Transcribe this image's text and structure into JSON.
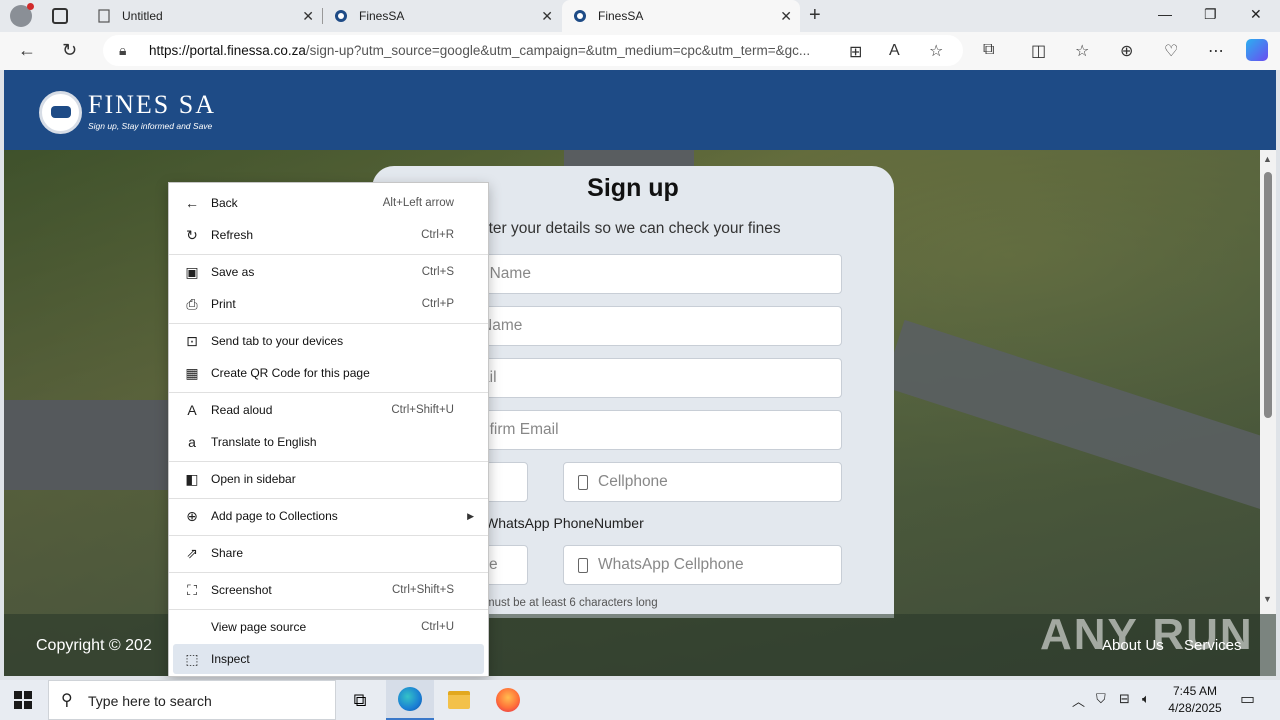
{
  "browser": {
    "tabs": [
      {
        "label": "Untitled",
        "active": false
      },
      {
        "label": "FinesSA",
        "active": false
      },
      {
        "label": "FinesSA",
        "active": true
      }
    ],
    "url_host": "https://portal.finessa.co.za",
    "url_rest": "/sign-up?utm_source=google&utm_campaign=&utm_medium=cpc&utm_term=&gc..."
  },
  "site": {
    "logo_text": "FINES SA",
    "logo_tagline": "Sign up, Stay informed and Save"
  },
  "form": {
    "title": "Sign up",
    "subtitle": "nter your details so we can check your fines",
    "first_name_placeholder": "t Name",
    "last_name_placeholder": " Name",
    "email_placeholder": "ail",
    "confirm_email_placeholder": "nfirm Email",
    "cellphone_placeholder": "Cellphone",
    "whatsapp_label": "WhatsApp PhoneNumber",
    "whatsapp_code_placeholder": "e",
    "whatsapp_cell_placeholder": "WhatsApp Cellphone",
    "password_hint": "must be at least 6 characters long"
  },
  "footer": {
    "copyright": "Copyright © 202",
    "about": "About Us",
    "services": "Services",
    "watermark": "ANY RUN"
  },
  "context_menu": [
    {
      "icon": "back-arrow-icon",
      "label": "Back",
      "shortcut": "Alt+Left arrow"
    },
    {
      "icon": "refresh-icon",
      "label": "Refresh",
      "shortcut": "Ctrl+R"
    },
    {
      "icon": "save-icon",
      "label": "Save as",
      "shortcut": "Ctrl+S"
    },
    {
      "icon": "print-icon",
      "label": "Print",
      "shortcut": "Ctrl+P"
    },
    {
      "icon": "send-devices-icon",
      "label": "Send tab to your devices",
      "shortcut": ""
    },
    {
      "icon": "qr-code-icon",
      "label": "Create QR Code for this page",
      "shortcut": ""
    },
    {
      "icon": "read-aloud-icon",
      "label": "Read aloud",
      "shortcut": "Ctrl+Shift+U"
    },
    {
      "icon": "translate-icon",
      "label": "Translate to English",
      "shortcut": ""
    },
    {
      "icon": "sidebar-icon",
      "label": "Open in sidebar",
      "shortcut": ""
    },
    {
      "icon": "collections-icon",
      "label": "Add page to Collections",
      "shortcut": ""
    },
    {
      "icon": "share-icon",
      "label": "Share",
      "shortcut": ""
    },
    {
      "icon": "screenshot-icon",
      "label": "Screenshot",
      "shortcut": "Ctrl+Shift+S"
    },
    {
      "icon": "",
      "label": "View page source",
      "shortcut": "Ctrl+U"
    },
    {
      "icon": "inspect-icon",
      "label": "Inspect",
      "shortcut": ""
    }
  ],
  "taskbar": {
    "search_placeholder": "Type here to search",
    "time": "7:45 AM",
    "date": "4/28/2025"
  }
}
